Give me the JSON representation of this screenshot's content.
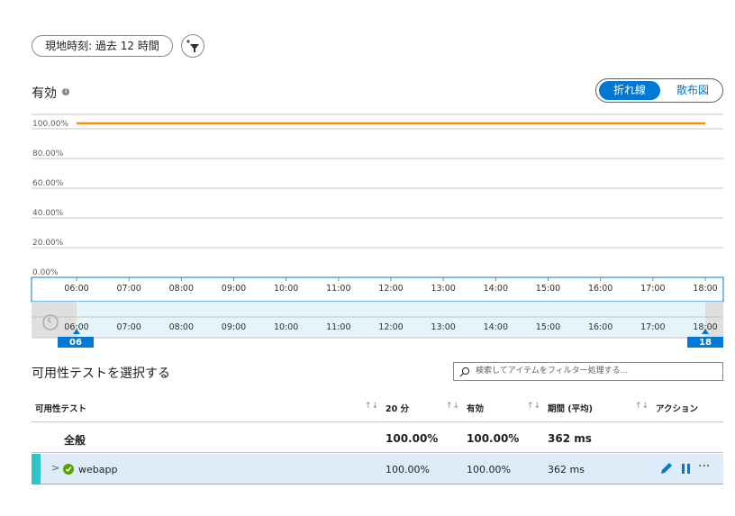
{
  "filter": {
    "time_range": "現地時刻: 過去 12 時間"
  },
  "panel": {
    "title": "有効",
    "view_toggle": {
      "active": "折れ線",
      "inactive": "散布図"
    }
  },
  "chart_data": {
    "type": "line",
    "y_ticks": [
      "100.00%",
      "80.00%",
      "60.00%",
      "40.00%",
      "20.00%",
      "0.00%"
    ],
    "ylim": [
      0,
      100
    ],
    "x_ticks": [
      "06:00",
      "07:00",
      "08:00",
      "09:00",
      "10:00",
      "11:00",
      "12:00",
      "13:00",
      "14:00",
      "15:00",
      "16:00",
      "17:00",
      "18:00"
    ],
    "series": [
      {
        "color": "#ff8c00",
        "x": [
          "06:00",
          "18:00"
        ],
        "values": [
          100,
          100
        ]
      }
    ],
    "brush": {
      "start_label": "06",
      "end_label": "18",
      "ticks": [
        "06:00",
        "07:00",
        "08:00",
        "09:00",
        "10:00",
        "11:00",
        "12:00",
        "13:00",
        "14:00",
        "15:00",
        "16:00",
        "17:00",
        "18:00"
      ]
    }
  },
  "tests": {
    "title": "可用性テストを選択する",
    "search_placeholder": "検索してアイテムをフィルター処理する...",
    "columns": {
      "name": "可用性テスト",
      "c20": "20 分",
      "avail": "有効",
      "duration": "期間 (平均)",
      "actions": "アクション"
    },
    "sort_glyph": "↑↓",
    "summary": {
      "name": "全般",
      "c20": "100.00%",
      "avail": "100.00%",
      "duration": "362 ms"
    },
    "rows": [
      {
        "name": "webapp",
        "c20": "100.00%",
        "avail": "100.00%",
        "duration": "362 ms"
      }
    ],
    "more_glyph": "···",
    "colors": {
      "accent": "#0078d4",
      "line": "#ff8c00",
      "success": "#57a300",
      "row_selected": "#deecf9",
      "row_stripe": "#2ec4c8"
    }
  }
}
